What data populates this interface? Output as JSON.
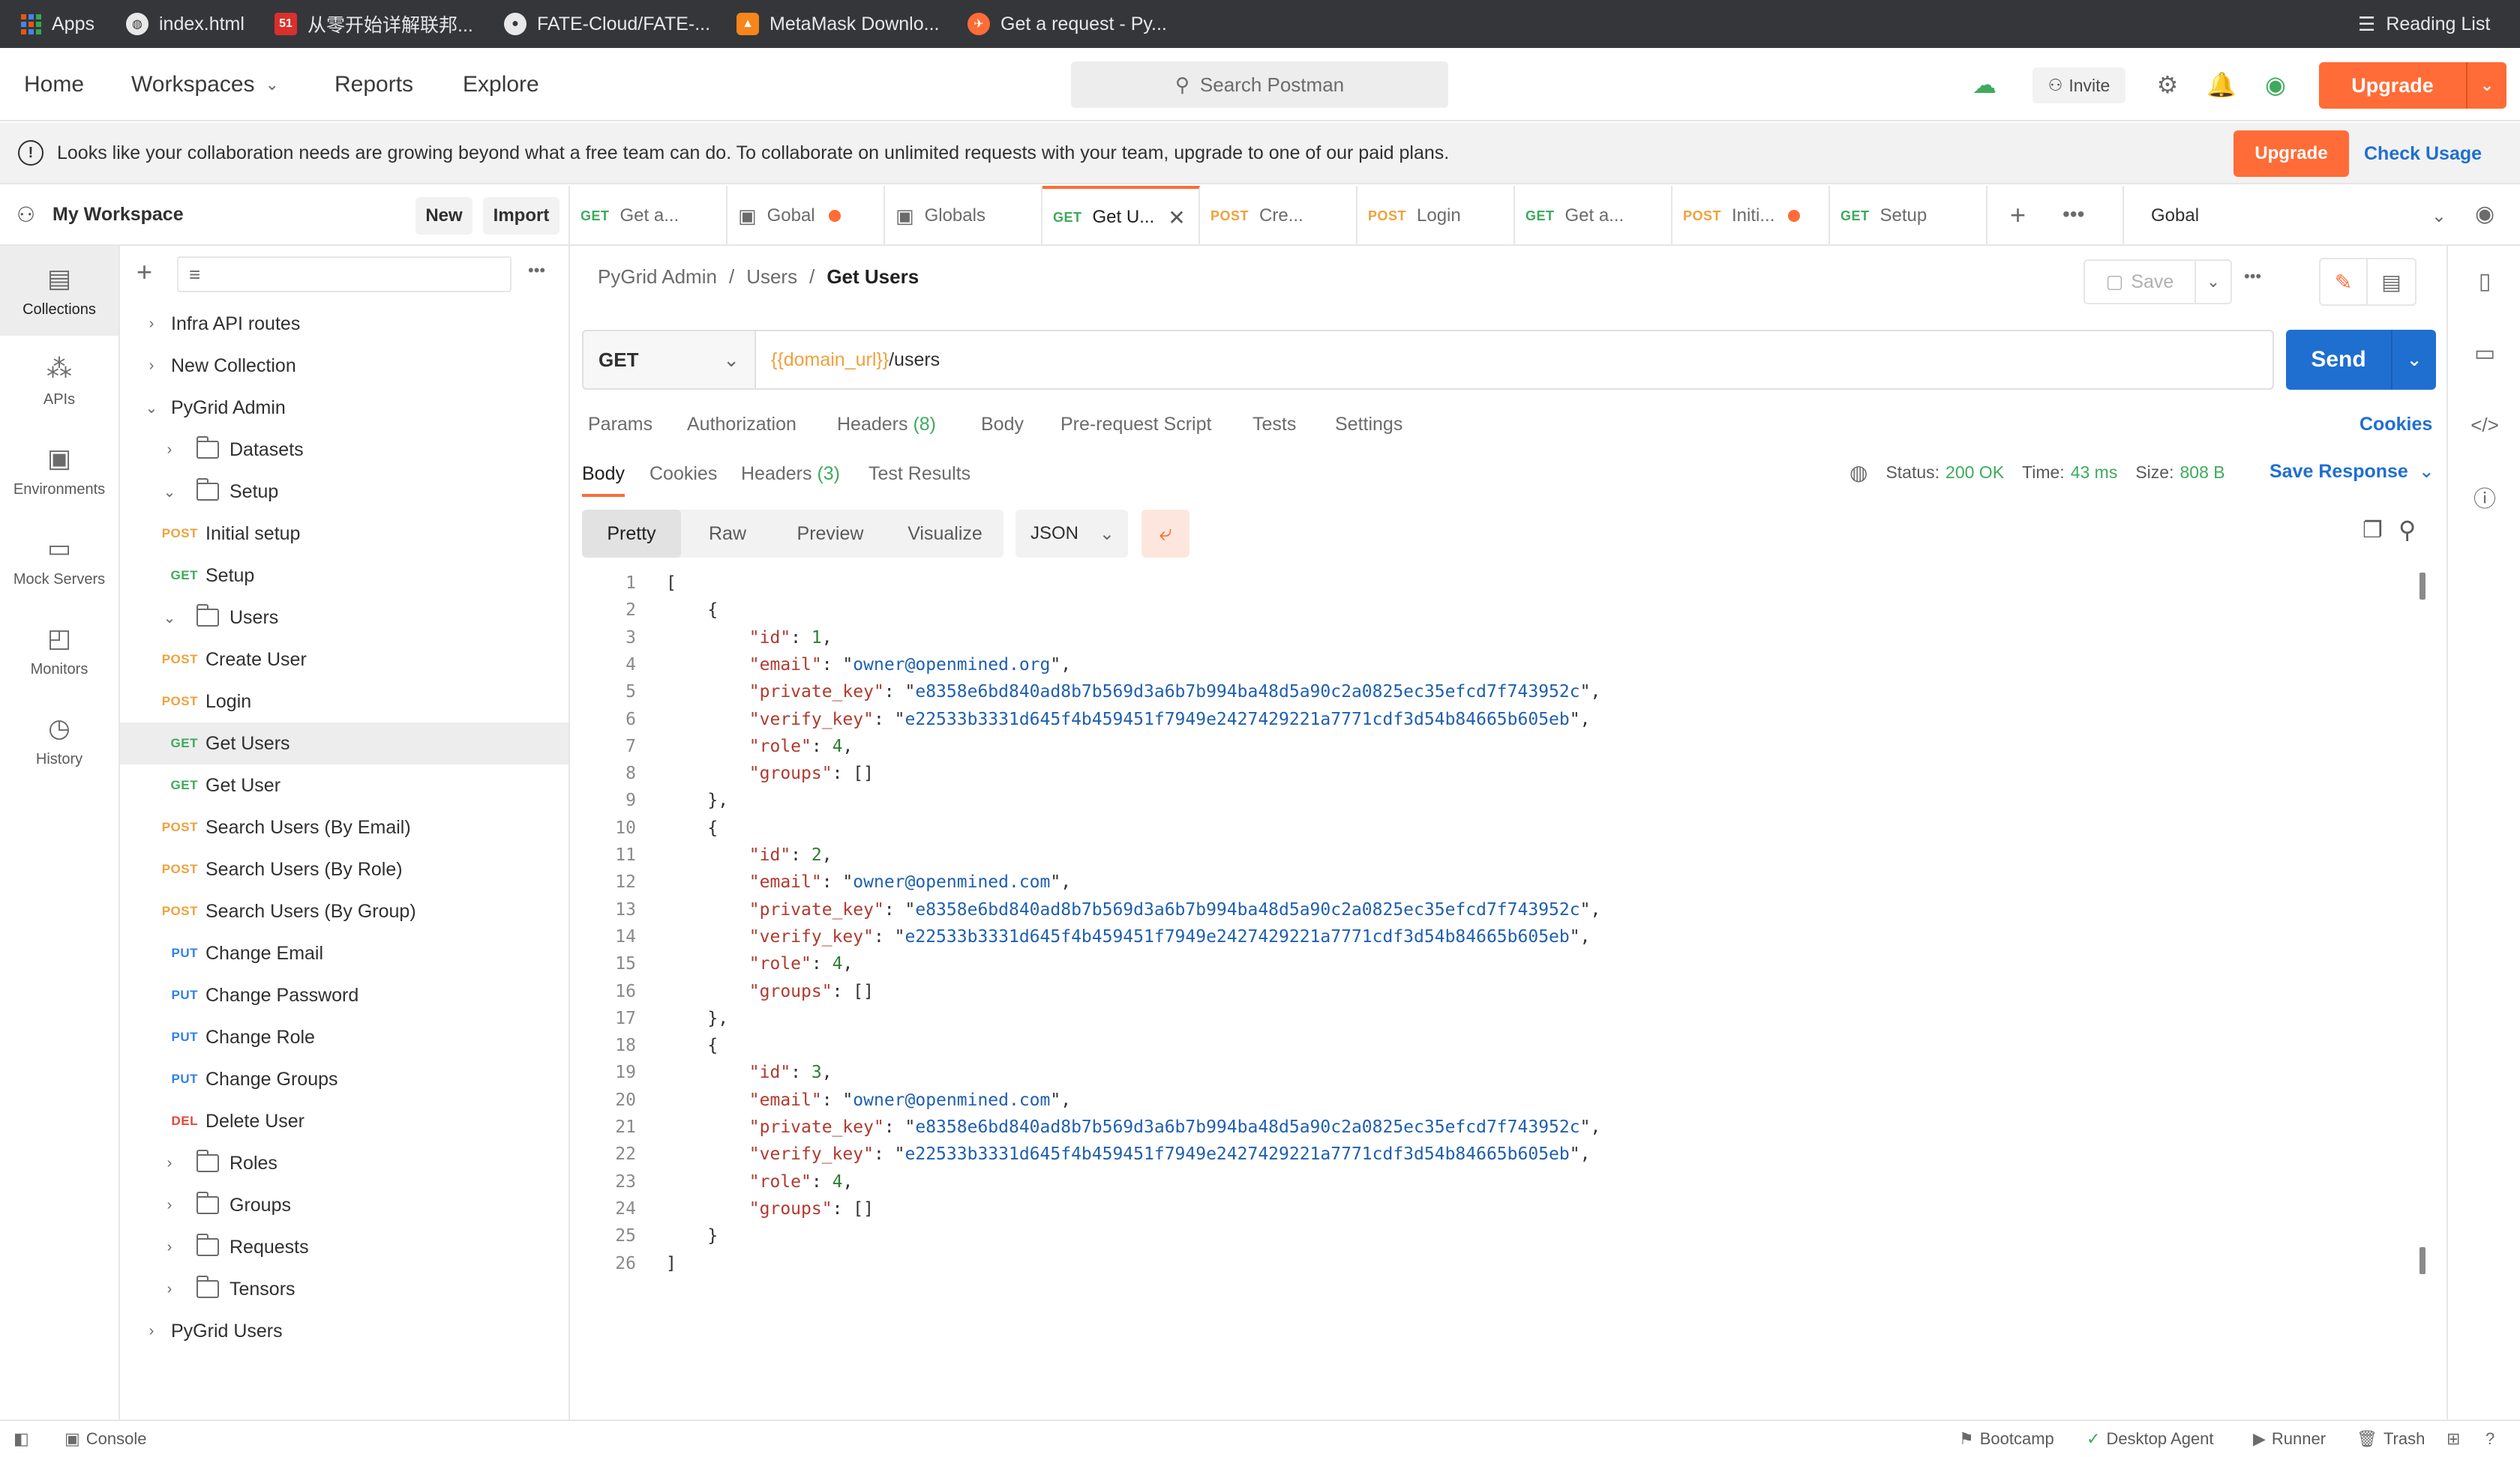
{
  "bookmarks": [
    {
      "label": "Apps"
    },
    {
      "label": "index.html"
    },
    {
      "label": "从零开始详解联邦..."
    },
    {
      "label": "FATE-Cloud/FATE-..."
    },
    {
      "label": "MetaMask Downlo..."
    },
    {
      "label": "Get a request - Py..."
    }
  ],
  "reading_list": "Reading List",
  "header": {
    "home": "Home",
    "workspaces": "Workspaces",
    "reports": "Reports",
    "explore": "Explore",
    "search_placeholder": "Search Postman",
    "invite": "Invite",
    "upgrade": "Upgrade"
  },
  "banner": {
    "message": "Looks like your collaboration needs are growing beyond what a free team can do. To collaborate on unlimited requests with your team, upgrade to one of our paid plans.",
    "upgrade": "Upgrade",
    "check_usage": "Check Usage"
  },
  "workspace": {
    "name": "My Workspace",
    "new": "New",
    "import": "Import"
  },
  "tabs": [
    {
      "method": "GET",
      "label": "Get a...",
      "dot": false
    },
    {
      "method": "",
      "label": "Gobal",
      "dot": true
    },
    {
      "method": "",
      "label": "Globals",
      "dot": false
    },
    {
      "method": "GET",
      "label": "Get U...",
      "dot": false,
      "active": true
    },
    {
      "method": "POST",
      "label": "Cre...",
      "dot": false
    },
    {
      "method": "POST",
      "label": "Login",
      "dot": false
    },
    {
      "method": "GET",
      "label": "Get a...",
      "dot": false
    },
    {
      "method": "POST",
      "label": "Initi...",
      "dot": true
    },
    {
      "method": "GET",
      "label": "Setup",
      "dot": false
    }
  ],
  "environment": "Gobal",
  "rail": [
    {
      "label": "Collections"
    },
    {
      "label": "APIs"
    },
    {
      "label": "Environments"
    },
    {
      "label": "Mock Servers"
    },
    {
      "label": "Monitors"
    },
    {
      "label": "History"
    }
  ],
  "tree": [
    {
      "label": "Infra API routes",
      "level": 0,
      "type": "collection"
    },
    {
      "label": "New Collection",
      "level": 0,
      "type": "collection"
    },
    {
      "label": "PyGrid Admin",
      "level": 0,
      "type": "collection",
      "open": true
    },
    {
      "label": "Datasets",
      "level": 1,
      "type": "folder"
    },
    {
      "label": "Setup",
      "level": 1,
      "type": "folder",
      "open": true
    },
    {
      "label": "Initial setup",
      "level": 2,
      "type": "request",
      "method": "POST"
    },
    {
      "label": "Setup",
      "level": 2,
      "type": "request",
      "method": "GET"
    },
    {
      "label": "Users",
      "level": 1,
      "type": "folder",
      "open": true
    },
    {
      "label": "Create User",
      "level": 2,
      "type": "request",
      "method": "POST"
    },
    {
      "label": "Login",
      "level": 2,
      "type": "request",
      "method": "POST"
    },
    {
      "label": "Get Users",
      "level": 2,
      "type": "request",
      "method": "GET",
      "selected": true
    },
    {
      "label": "Get User",
      "level": 2,
      "type": "request",
      "method": "GET"
    },
    {
      "label": "Search Users (By Email)",
      "level": 2,
      "type": "request",
      "method": "POST"
    },
    {
      "label": "Search Users (By Role)",
      "level": 2,
      "type": "request",
      "method": "POST"
    },
    {
      "label": "Search Users (By Group)",
      "level": 2,
      "type": "request",
      "method": "POST"
    },
    {
      "label": "Change Email",
      "level": 2,
      "type": "request",
      "method": "PUT"
    },
    {
      "label": "Change Password",
      "level": 2,
      "type": "request",
      "method": "PUT"
    },
    {
      "label": "Change Role",
      "level": 2,
      "type": "request",
      "method": "PUT"
    },
    {
      "label": "Change Groups",
      "level": 2,
      "type": "request",
      "method": "PUT"
    },
    {
      "label": "Delete User",
      "level": 2,
      "type": "request",
      "method": "DEL"
    },
    {
      "label": "Roles",
      "level": 1,
      "type": "folder"
    },
    {
      "label": "Groups",
      "level": 1,
      "type": "folder"
    },
    {
      "label": "Requests",
      "level": 1,
      "type": "folder"
    },
    {
      "label": "Tensors",
      "level": 1,
      "type": "folder"
    },
    {
      "label": "PyGrid Users",
      "level": 0,
      "type": "collection"
    }
  ],
  "breadcrumb": {
    "part1": "PyGrid Admin",
    "sep": "/",
    "part2": "Users",
    "current": "Get Users"
  },
  "request": {
    "save": "Save",
    "method": "GET",
    "url_var": "{{domain_url}}",
    "url_path": "/users",
    "send": "Send"
  },
  "request_tabs": {
    "params": "Params",
    "authorization": "Authorization",
    "headers": "Headers",
    "headers_count": "(8)",
    "body": "Body",
    "prerequest": "Pre-request Script",
    "tests": "Tests",
    "settings": "Settings",
    "cookies": "Cookies"
  },
  "response_tabs": {
    "body": "Body",
    "cookies": "Cookies",
    "headers": "Headers",
    "headers_count": "(3)",
    "test_results": "Test Results"
  },
  "response_meta": {
    "status_label": "Status:",
    "status_value": "200 OK",
    "time_label": "Time:",
    "time_value": "43 ms",
    "size_label": "Size:",
    "size_value": "808 B",
    "save_response": "Save Response"
  },
  "format": {
    "pretty": "Pretty",
    "raw": "Raw",
    "preview": "Preview",
    "visualize": "Visualize",
    "lang": "JSON"
  },
  "users": [
    {
      "id": "1",
      "email": "owner@openmined.org",
      "private_key": "e8358e6bd840ad8b7b569d3a6b7b994ba48d5a90c2a0825ec35efcd7f743952c",
      "verify_key": "e22533b3331d645f4b459451f7949e2427429221a7771cdf3d54b84665b605eb",
      "role": "4"
    },
    {
      "id": "2",
      "email": "owner@openmined.com",
      "private_key": "e8358e6bd840ad8b7b569d3a6b7b994ba48d5a90c2a0825ec35efcd7f743952c",
      "verify_key": "e22533b3331d645f4b459451f7949e2427429221a7771cdf3d54b84665b605eb",
      "role": "4"
    },
    {
      "id": "3",
      "email": "owner@openmined.com",
      "private_key": "e8358e6bd840ad8b7b569d3a6b7b994ba48d5a90c2a0825ec35efcd7f743952c",
      "verify_key": "e22533b3331d645f4b459451f7949e2427429221a7771cdf3d54b84665b605eb",
      "role": "4"
    }
  ],
  "footer": {
    "console": "Console",
    "bootcamp": "Bootcamp",
    "desktop_agent": "Desktop Agent",
    "runner": "Runner",
    "trash": "Trash"
  }
}
